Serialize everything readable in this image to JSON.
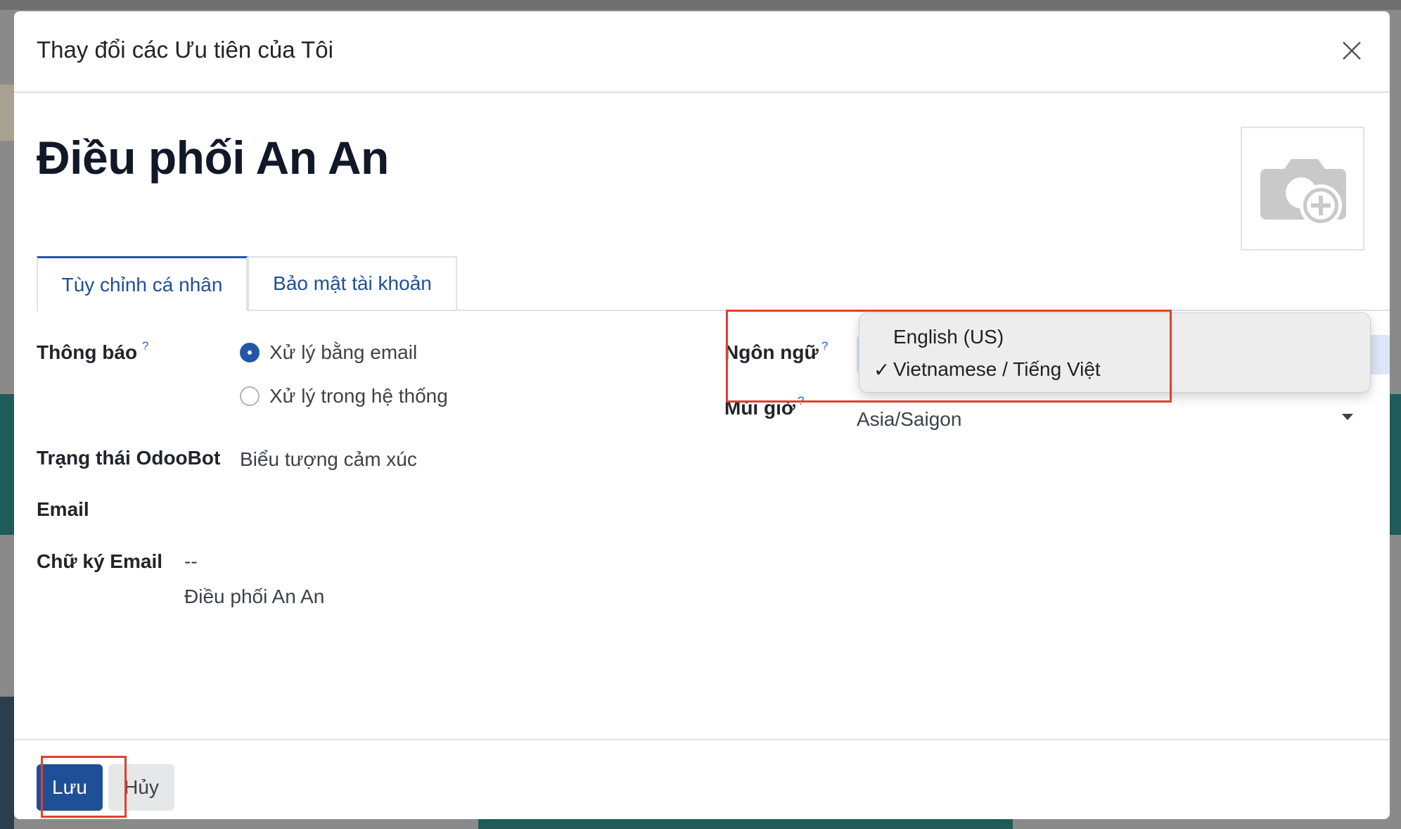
{
  "modal": {
    "title": "Thay đổi các Ưu tiên của Tôi",
    "record_name": "Điều phối An An"
  },
  "tabs": [
    {
      "label": "Tùy chỉnh cá nhân",
      "active": true
    },
    {
      "label": "Bảo mật tài khoản",
      "active": false
    }
  ],
  "form": {
    "notification": {
      "label": "Thông báo",
      "help": "?",
      "options": [
        {
          "label": "Xử lý bằng email",
          "checked": true
        },
        {
          "label": "Xử lý trong hệ thống",
          "checked": false
        }
      ]
    },
    "odoobot_status": {
      "label": "Trạng thái OdooBot",
      "value": "Biểu tượng cảm xúc"
    },
    "email": {
      "label": "Email",
      "value": ""
    },
    "signature": {
      "label": "Chữ ký Email",
      "line1": "--",
      "line2": "Điều phối An An"
    },
    "language": {
      "label": "Ngôn ngữ",
      "help": "?",
      "dropdown_options": [
        {
          "label": "English (US)",
          "selected": false
        },
        {
          "label": "Vietnamese / Tiếng Việt",
          "selected": true
        }
      ],
      "check_mark": "✓"
    },
    "timezone": {
      "label": "Múi giờ",
      "help": "?",
      "value": "Asia/Saigon"
    }
  },
  "footer": {
    "save_label": "Lưu",
    "cancel_label": "Hủy"
  },
  "colors": {
    "primary": "#1f4f97",
    "highlight": "#e1402d",
    "help": "#2563eb"
  }
}
